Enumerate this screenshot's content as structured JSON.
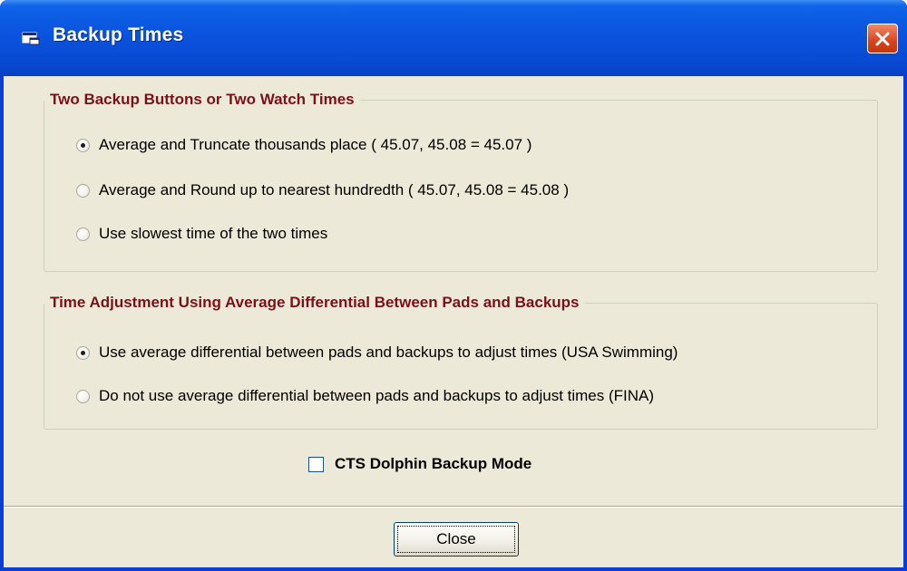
{
  "window": {
    "title": "Backup Times"
  },
  "group1": {
    "legend": "Two Backup Buttons or Two Watch Times",
    "options": [
      {
        "label": "Average and Truncate thousands place   ( 45.07, 45.08 = 45.07 )",
        "checked": true
      },
      {
        "label": "Average and Round up to nearest hundredth   ( 45.07, 45.08 = 45.08 )",
        "checked": false
      },
      {
        "label": "Use slowest time of the two times",
        "checked": false
      }
    ]
  },
  "group2": {
    "legend": "Time Adjustment Using Average Differential Between Pads and Backups",
    "options": [
      {
        "label": "Use average differential between pads and backups to adjust times (USA Swimming)",
        "checked": true
      },
      {
        "label": "Do not use average differential between pads and backups to adjust times (FINA)",
        "checked": false
      }
    ]
  },
  "checkbox": {
    "label": "CTS Dolphin Backup Mode",
    "checked": false
  },
  "buttons": {
    "close_label": "Close"
  },
  "icons": {
    "title_icon": "app-window-icon",
    "close_icon": "close-x-icon"
  },
  "colors": {
    "titlebar": "#0a55e0",
    "legend_text": "#7a1118",
    "dialog_bg": "#ece9d8",
    "close_button": "#d9431b"
  }
}
